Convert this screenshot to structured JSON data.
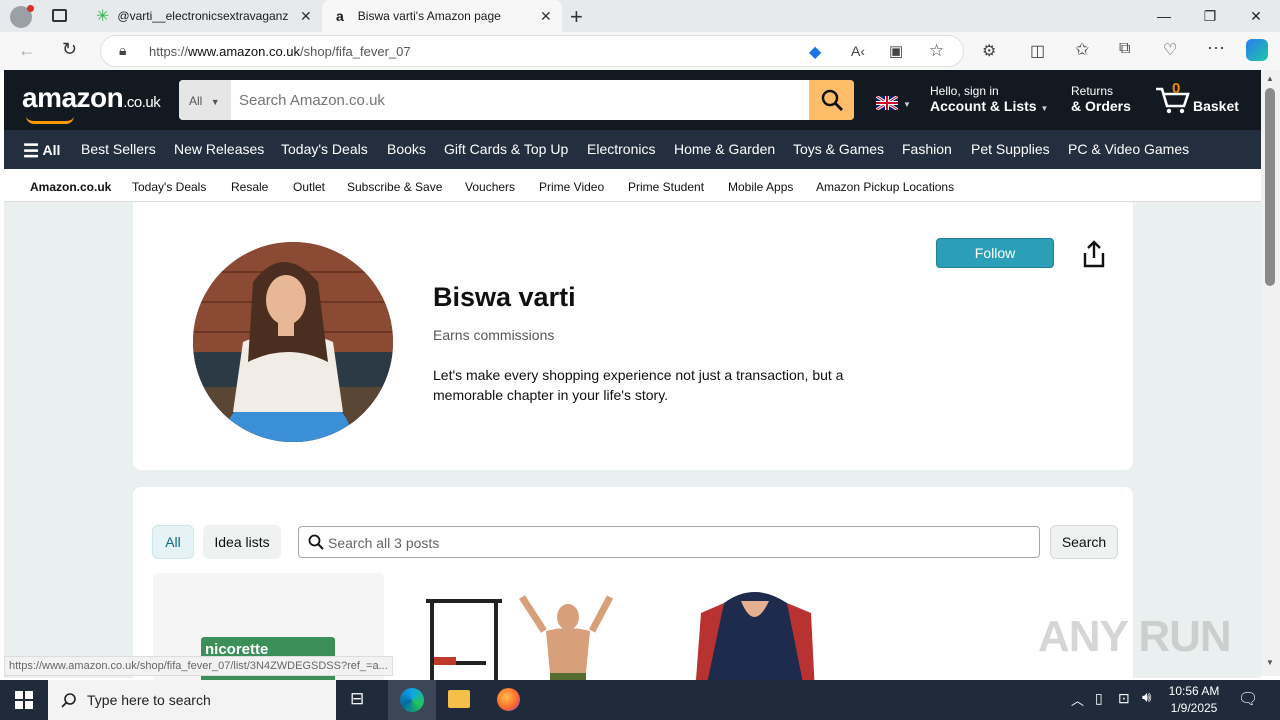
{
  "browser": {
    "tabs": [
      {
        "title": "@varti__electronicsextravaganza",
        "active": false
      },
      {
        "title": "Biswa varti's Amazon page",
        "active": true
      }
    ],
    "url_prefix": "https://",
    "url_host": "www.amazon.co.uk",
    "url_path": "/shop/fifa_fever_07",
    "status_url": "https://www.amazon.co.uk/shop/fifa_fever_07/list/3N4ZWDEGSDSS?ref_=a..."
  },
  "amazon_header": {
    "logo_text": "amazon",
    "logo_tld": ".co.uk",
    "search_category": "All",
    "search_placeholder": "Search Amazon.co.uk",
    "greeting": "Hello, sign in",
    "account_label": "Account & Lists",
    "returns_label": "Returns",
    "orders_label": "& Orders",
    "basket_count": "0",
    "basket_label": "Basket"
  },
  "nav": {
    "all_label": "All",
    "items": [
      "Best Sellers",
      "New Releases",
      "Today's Deals",
      "Books",
      "Gift Cards & Top Up",
      "Electronics",
      "Home & Garden",
      "Toys & Games",
      "Fashion",
      "Pet Supplies",
      "PC & Video Games"
    ]
  },
  "subnav": {
    "items": [
      "Amazon.co.uk",
      "Today's Deals",
      "Resale",
      "Outlet",
      "Subscribe & Save",
      "Vouchers",
      "Prime Video",
      "Prime Student",
      "Mobile Apps",
      "Amazon Pickup Locations"
    ]
  },
  "profile": {
    "name": "Biswa varti",
    "earns": "Earns commissions",
    "bio": "Let's make every shopping experience not just a transaction, but a memorable chapter in your life's story.",
    "follow_label": "Follow"
  },
  "posts": {
    "tab_all": "All",
    "tab_idea": "Idea lists",
    "search_placeholder": "Search all 3 posts",
    "search_button": "Search",
    "thumb1_brand": "nicorette"
  },
  "taskbar": {
    "search_placeholder": "Type here to search",
    "time": "10:56 AM",
    "date": "1/9/2025"
  },
  "watermark": "ANY RUN",
  "colors": {
    "amazon_dark": "#131921",
    "amazon_nav": "#232f3e",
    "amazon_orange": "#febd69",
    "follow_teal": "#2c9fb8"
  }
}
